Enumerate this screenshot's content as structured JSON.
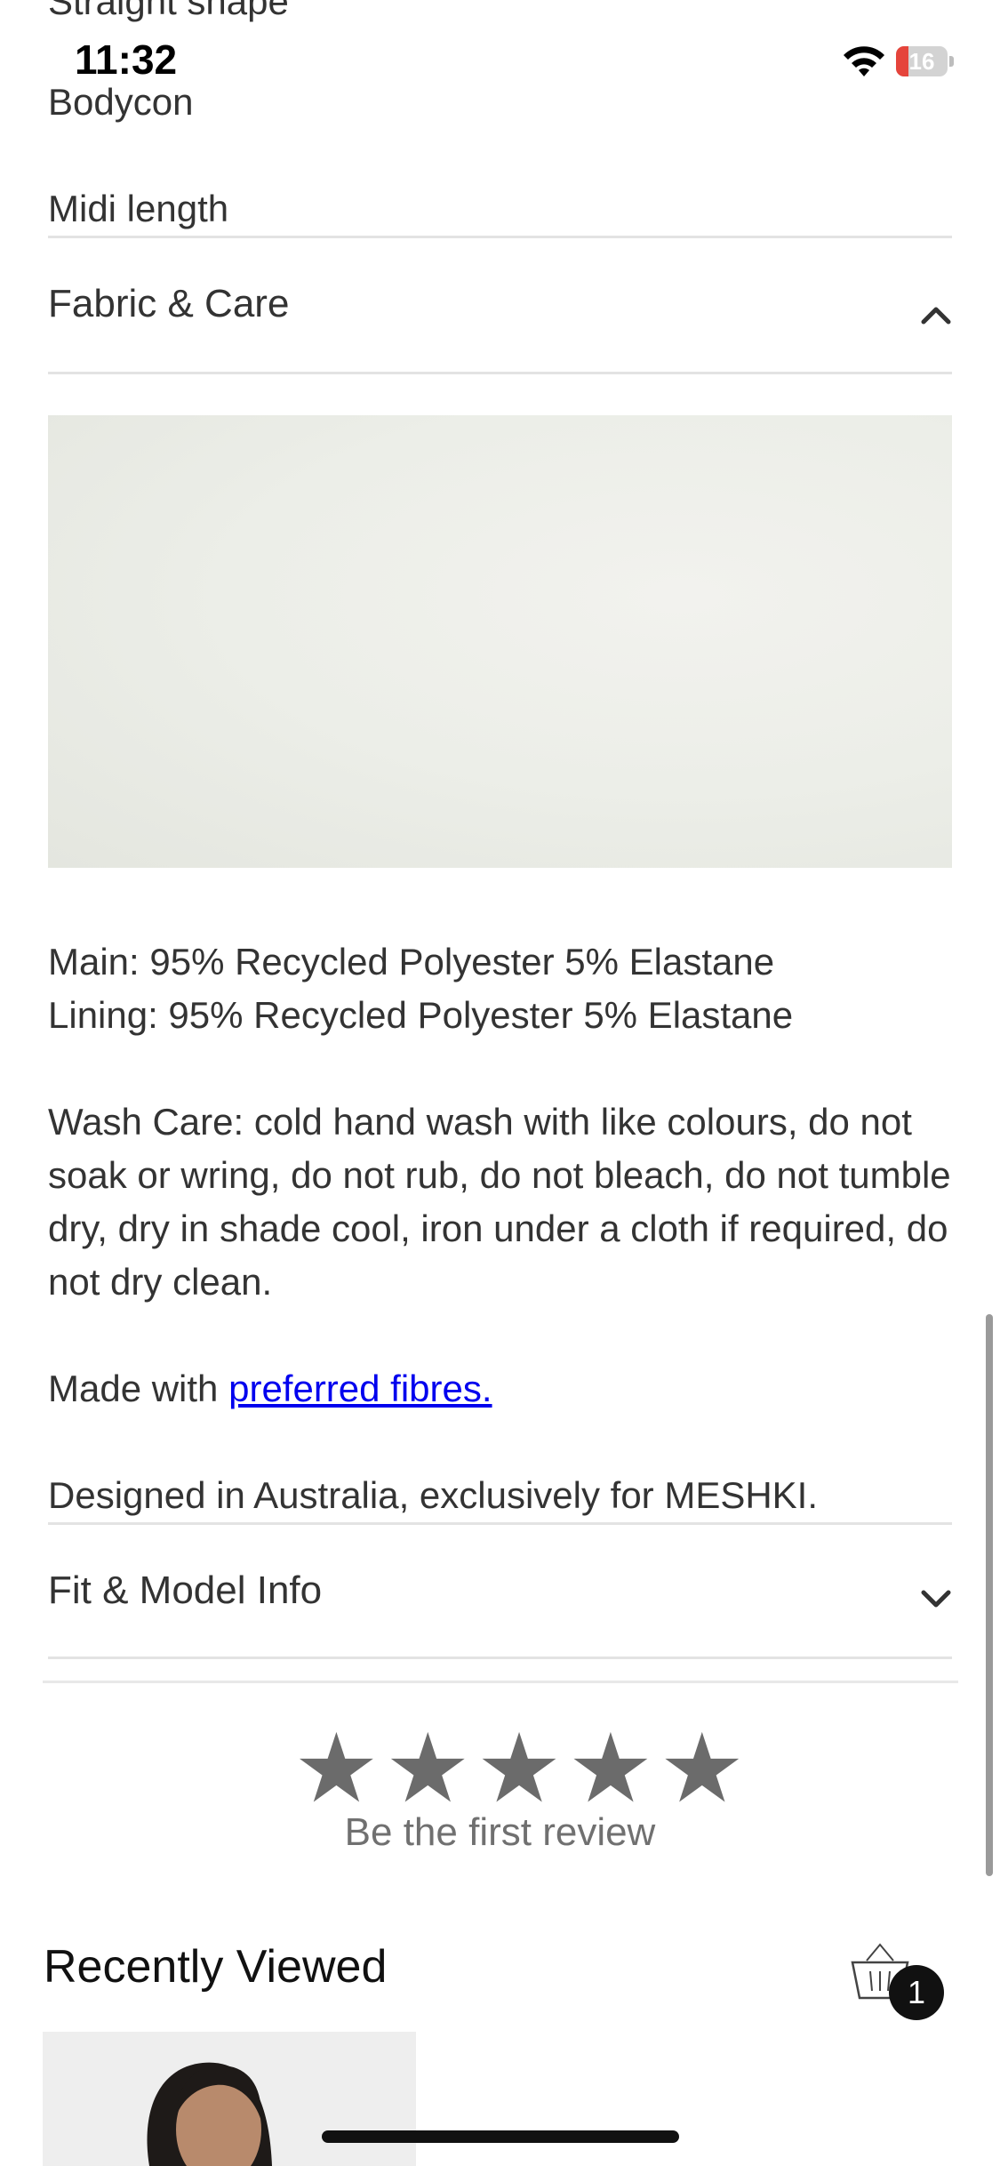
{
  "status_bar": {
    "time": "11:32",
    "battery_level": "16",
    "battery_color": "#e5443b"
  },
  "details_list": {
    "items": [
      "Straight shape",
      "Bodycon",
      "Midi length"
    ]
  },
  "fabric_care": {
    "title": "Fabric & Care",
    "expanded": true,
    "main": "Main: 95% Recycled Polyester 5% Elastane",
    "lining": "Lining: 95% Recycled Polyester 5% Elastane",
    "wash_care": "Wash Care: cold hand wash with like colours, do not soak or wring, do not rub, do not bleach, do not tumble dry, dry in shade cool, iron under a cloth if required, do not dry clean.",
    "made_with_prefix": "Made with ",
    "made_with_link": "preferred fibres.",
    "designed_in": "Designed in Australia, exclusively for MESHKI."
  },
  "fit_model": {
    "title": "Fit & Model Info",
    "expanded": false
  },
  "reviews": {
    "star_count": 5,
    "cta": "Be the first review"
  },
  "recently_viewed": {
    "title": "Recently Viewed",
    "cart_count": "1"
  },
  "colors": {
    "link": "#0000ee",
    "text": "#333333",
    "star": "#6b6b6b"
  }
}
